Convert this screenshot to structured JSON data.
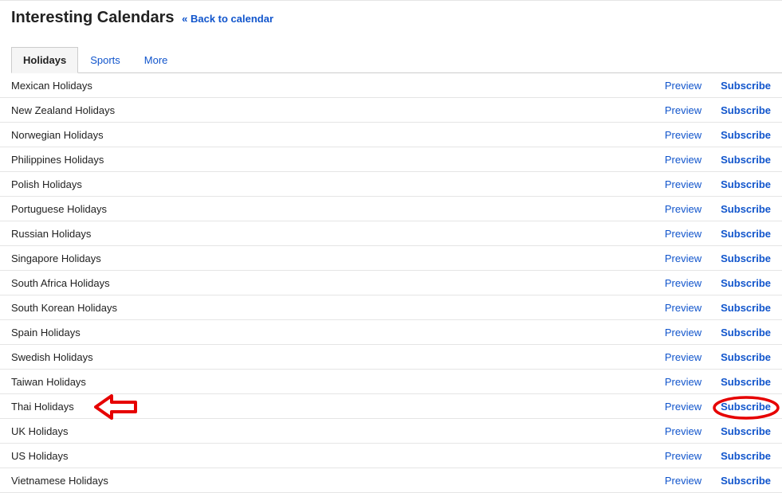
{
  "header": {
    "title": "Interesting Calendars",
    "back_link": "« Back to calendar"
  },
  "tabs": [
    {
      "label": "Holidays",
      "active": true
    },
    {
      "label": "Sports",
      "active": false
    },
    {
      "label": "More",
      "active": false
    }
  ],
  "action_labels": {
    "preview": "Preview",
    "subscribe": "Subscribe"
  },
  "calendars": [
    {
      "name": "Mexican Holidays"
    },
    {
      "name": "New Zealand Holidays"
    },
    {
      "name": "Norwegian Holidays"
    },
    {
      "name": "Philippines Holidays"
    },
    {
      "name": "Polish Holidays"
    },
    {
      "name": "Portuguese Holidays"
    },
    {
      "name": "Russian Holidays"
    },
    {
      "name": "Singapore Holidays"
    },
    {
      "name": "South Africa Holidays"
    },
    {
      "name": "South Korean Holidays"
    },
    {
      "name": "Spain Holidays"
    },
    {
      "name": "Swedish Holidays"
    },
    {
      "name": "Taiwan Holidays"
    },
    {
      "name": "Thai Holidays",
      "highlight_arrow": true,
      "highlight_circle": true
    },
    {
      "name": "UK Holidays"
    },
    {
      "name": "US Holidays"
    },
    {
      "name": "Vietnamese Holidays"
    }
  ],
  "annotation": {
    "color": "#e60000"
  }
}
